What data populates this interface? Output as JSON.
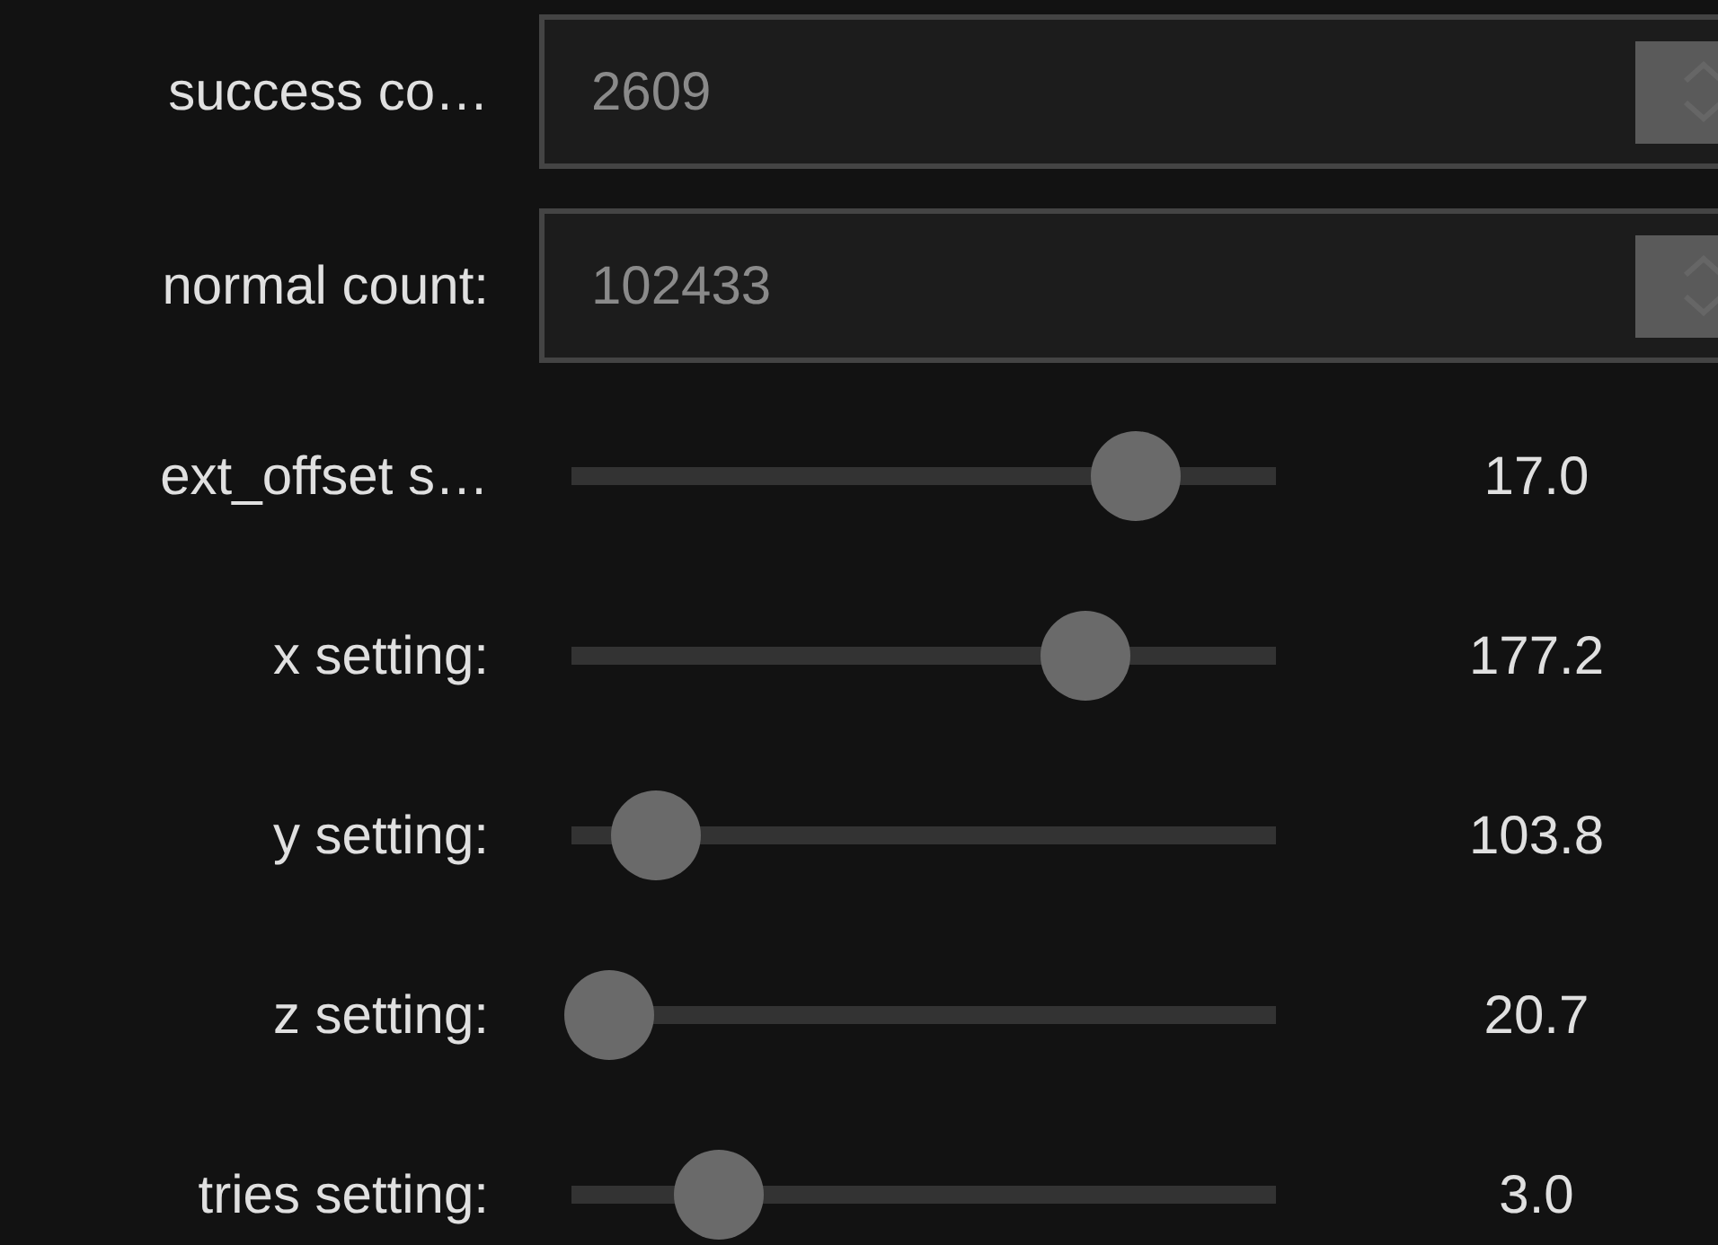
{
  "fields": [
    {
      "label": "success co…",
      "value": "2609",
      "disabled": true
    },
    {
      "label": "normal count:",
      "value": "102433",
      "disabled": true
    }
  ],
  "sliders": [
    {
      "label": "ext_offset s…",
      "level": 0.81,
      "reading": "17.0"
    },
    {
      "label": "x setting:",
      "level": 0.74,
      "reading": "177.2"
    },
    {
      "label": "y setting:",
      "level": 0.13,
      "reading": "103.8"
    },
    {
      "label": "z setting:",
      "level": 0.0,
      "reading": "20.7"
    },
    {
      "label": "tries setting:",
      "level": 0.22,
      "reading": "3.0"
    }
  ]
}
